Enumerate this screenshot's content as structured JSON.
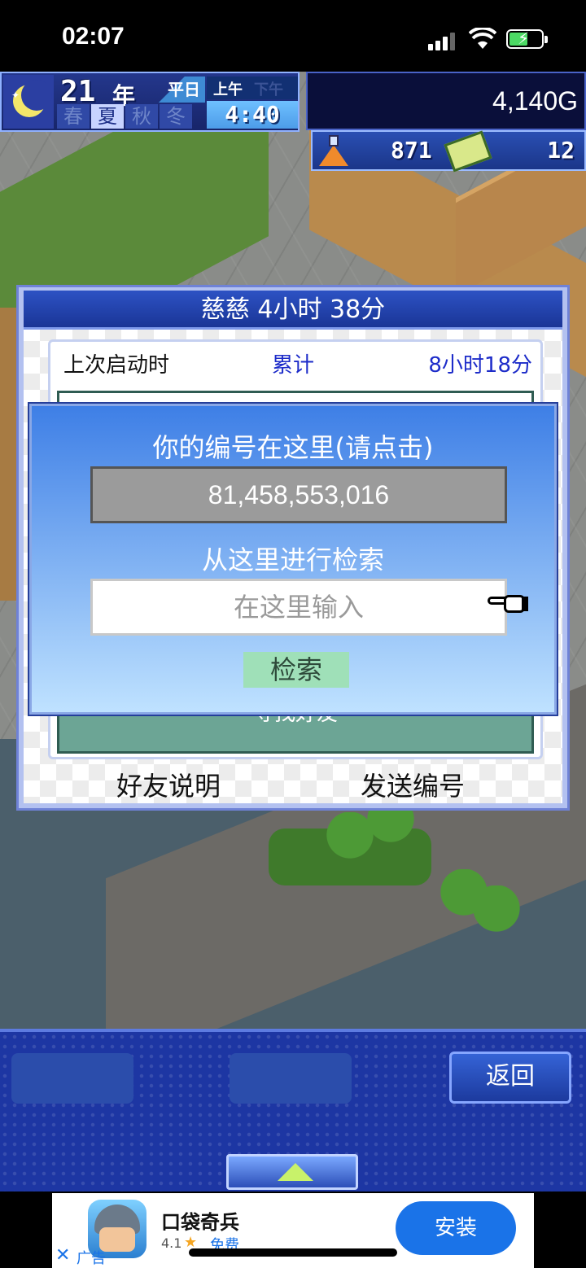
{
  "status_bar": {
    "time": "02:07"
  },
  "hud": {
    "year": "21",
    "year_unit": "年",
    "seasons": [
      "春",
      "夏",
      "秋",
      "冬"
    ],
    "active_season": "夏",
    "weekday": "平日",
    "am_label": "上午",
    "pm_label": "下午",
    "clock": "4:40",
    "gold": "4,140G",
    "research_points": "871",
    "tickets": "12"
  },
  "friends_dialog": {
    "title": "慈慈  4小时 38分",
    "last_launch_label": "上次启动时",
    "total_label": "累计",
    "total_value": "8小时18分",
    "find_friend_label": "寻找好友",
    "help_button": "好友说明",
    "send_id_button": "发送编号"
  },
  "id_popup": {
    "heading": "你的编号在这里(请点击)",
    "player_id": "81,458,553,016",
    "search_heading": "从这里进行检索",
    "search_placeholder": "在这里输入",
    "search_button": "检索"
  },
  "bottom_bar": {
    "back_button": "返回"
  },
  "ad": {
    "app_name": "口袋奇兵",
    "rating": "4.1",
    "price_label": "免费",
    "install_button": "安装",
    "ad_label": "广告"
  },
  "colors": {
    "hud_blue": "#24378c",
    "dialog_title": "#2d52c4",
    "link_blue": "#1d2cc9",
    "popup_top": "#3e7fe6",
    "popup_bottom": "#bfe2ff",
    "search_button": "#9fe0b8",
    "install_blue": "#1a73e8"
  },
  "icons": [
    "moon-icon",
    "flask-icon",
    "ticket-icon",
    "pointing-hand-icon",
    "signal-icon",
    "wifi-icon",
    "battery-icon",
    "up-arrow-icon",
    "close-icon"
  ]
}
